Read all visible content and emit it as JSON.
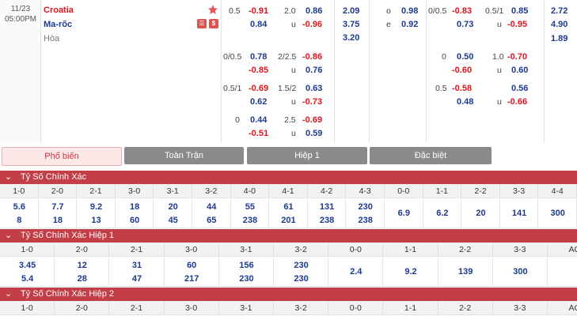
{
  "match": {
    "date": "11/23",
    "time": "05:00PM",
    "home": "Croatia",
    "away": "Ma-rốc",
    "draw": "Hòa",
    "badges": [
      "☰",
      "$"
    ],
    "full_time": {
      "handicap_rows": [
        {
          "line": "0.5",
          "home": "-0.91",
          "away": "0.84",
          "home_line": "",
          "away_line": ""
        },
        {
          "line": "0/0.5",
          "home": "0.78",
          "away": "-0.85"
        },
        {
          "line": "0.5/1",
          "home": "-0.69",
          "away": "0.62"
        },
        {
          "line": "0",
          "home": "0.44",
          "away": "-0.51"
        }
      ],
      "ou_rows": [
        {
          "line": "2.0",
          "over": "0.86",
          "under_label": "u",
          "under": "-0.96"
        },
        {
          "line": "2/2.5",
          "over": "-0.86",
          "under_label": "u",
          "under": "0.76"
        },
        {
          "line": "1.5/2",
          "over": "0.63",
          "under_label": "u",
          "under": "-0.73"
        },
        {
          "line": "2.5",
          "over": "-0.69",
          "under_label": "u",
          "under": "0.59"
        }
      ],
      "x12": [
        "2.09",
        "3.75",
        "3.20"
      ],
      "oe": [
        {
          "label": "o",
          "value": "0.98"
        },
        {
          "label": "e",
          "value": "0.92"
        }
      ]
    },
    "first_half": {
      "handicap_rows": [
        {
          "line": "0/0.5",
          "home": "-0.83",
          "away": "0.73"
        },
        {
          "line": "0",
          "home": "0.50",
          "away": "-0.60"
        },
        {
          "line": "0.5",
          "home": "-0.58",
          "away": "0.48"
        }
      ],
      "ou_rows": [
        {
          "line": "0.5/1",
          "over": "0.85",
          "under_label": "u",
          "under": "-0.95"
        },
        {
          "line": "1.0",
          "over": "-0.70",
          "under_label": "u",
          "under": "0.60"
        },
        {
          "line": "",
          "over": "0.56",
          "under_label": "u",
          "under": "-0.66"
        }
      ],
      "x12": [
        "2.72",
        "4.90",
        "1.89"
      ]
    }
  },
  "tabs": [
    {
      "label": "Phổ biến",
      "active": true
    },
    {
      "label": "Toàn Trận",
      "active": false
    },
    {
      "label": "Hiệp 1",
      "active": false
    },
    {
      "label": "Đặc biệt",
      "active": false
    }
  ],
  "sections": [
    {
      "title": "Tỷ Số Chính Xác",
      "scores": [
        "1-0",
        "2-0",
        "2-1",
        "3-0",
        "3-1",
        "3-2",
        "4-0",
        "4-1",
        "4-2",
        "4-3",
        "0-0",
        "1-1",
        "2-2",
        "3-3",
        "4-4"
      ],
      "values_top": [
        "5.6",
        "7.7",
        "9.2",
        "18",
        "20",
        "44",
        "55",
        "61",
        "131",
        "230",
        "6.9",
        "6.2",
        "20",
        "141",
        "300"
      ],
      "values_bottom": [
        "8",
        "18",
        "13",
        "60",
        "45",
        "65",
        "238",
        "201",
        "238",
        "238",
        "",
        "",
        "",
        "",
        ""
      ]
    },
    {
      "title": "Tỷ Số Chính Xác Hiệp 1",
      "scores": [
        "1-0",
        "2-0",
        "2-1",
        "3-0",
        "3-1",
        "3-2",
        "0-0",
        "1-1",
        "2-2",
        "3-3",
        "AO"
      ],
      "values_top": [
        "3.45",
        "12",
        "31",
        "60",
        "156",
        "230",
        "2.4",
        "9.2",
        "139",
        "300",
        ""
      ],
      "values_bottom": [
        "5.4",
        "28",
        "47",
        "217",
        "230",
        "230",
        "",
        "",
        "",
        "",
        ""
      ]
    },
    {
      "title": "Tỷ Số Chính Xác Hiệp 2",
      "scores": [
        "1-0",
        "2-0",
        "2-1",
        "3-0",
        "3-1",
        "3-2",
        "0-0",
        "1-1",
        "2-2",
        "3-3",
        "AO"
      ]
    }
  ],
  "colors": {
    "negative": "#e0141e",
    "positive": "#1c3a8c",
    "section": "#c43e48",
    "tab_inactive": "#8a8a8a"
  }
}
